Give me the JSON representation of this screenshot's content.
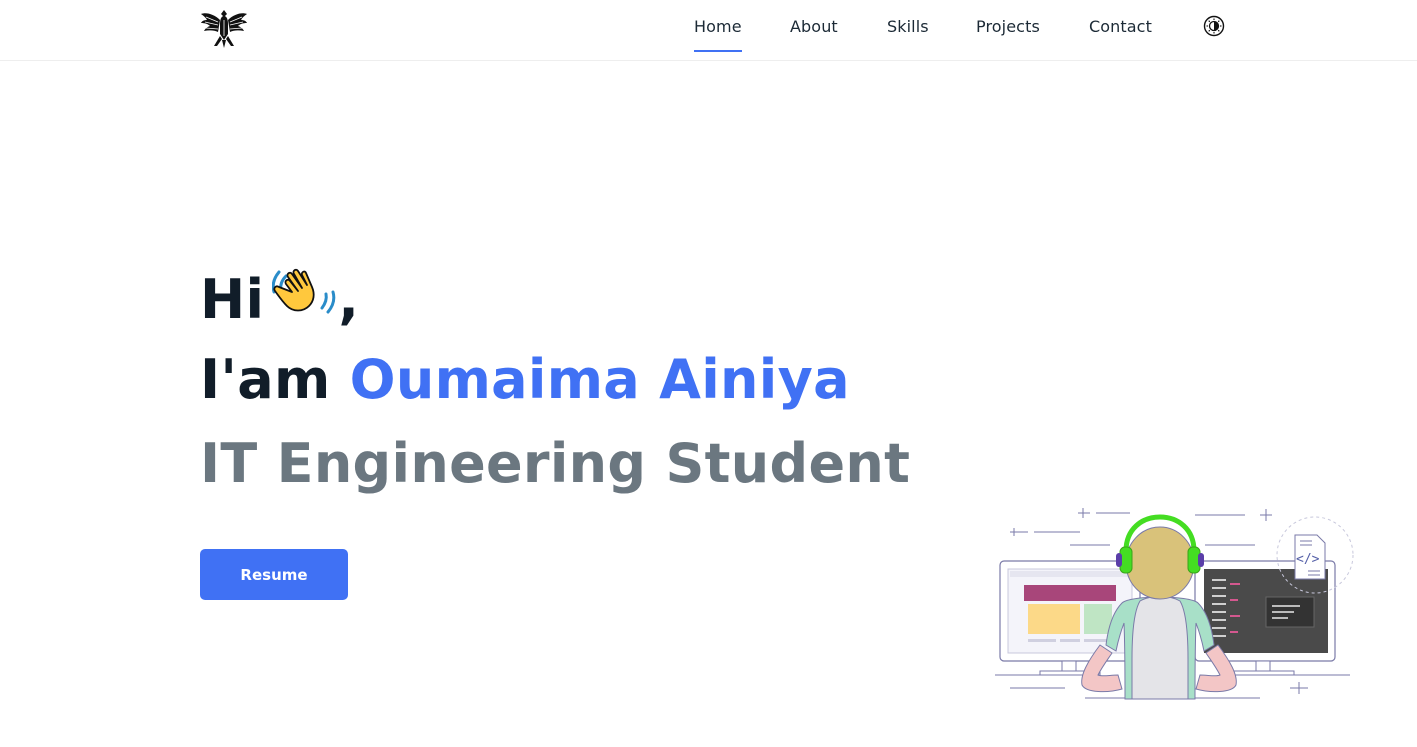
{
  "nav": {
    "links": [
      {
        "label": "Home",
        "active": true
      },
      {
        "label": "About",
        "active": false
      },
      {
        "label": "Skills",
        "active": false
      },
      {
        "label": "Projects",
        "active": false
      },
      {
        "label": "Contact",
        "active": false
      }
    ],
    "logo_icon": "eagle-crest-icon",
    "theme_toggle_icon": "theme-toggle-icon"
  },
  "hero": {
    "greeting": "Hi",
    "greeting_suffix": ",",
    "wave_icon": "waving-hand-icon",
    "intro_prefix": "I'am",
    "name": "Oumaima Ainiya",
    "role": "IT Engineering Student",
    "resume_label": "Resume"
  },
  "illustration": {
    "icon": "developer-at-monitors-illustration",
    "code_symbol": "</>"
  },
  "colors": {
    "accent": "#4071f4",
    "heading": "#111d29",
    "muted": "#6b7780",
    "nav_text": "#1c2a36",
    "headphones": "#44dd22"
  }
}
